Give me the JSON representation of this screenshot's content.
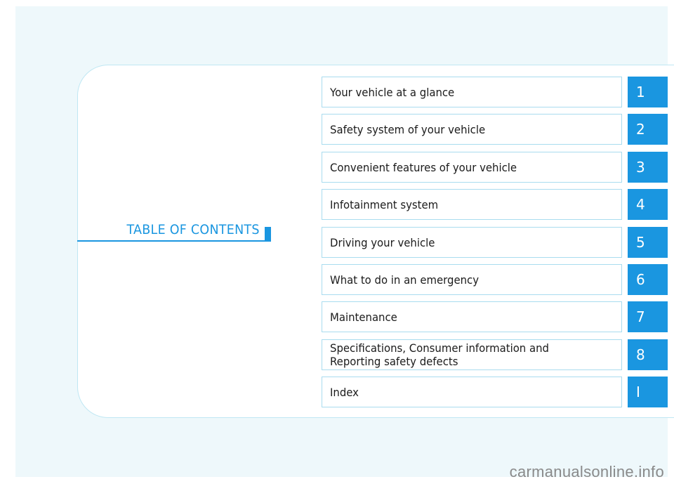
{
  "title": "TABLE OF CONTENTS",
  "colors": {
    "accent": "#1a96e0",
    "background": "#eef8fb",
    "border": "#a9dcef"
  },
  "chapters": [
    {
      "label": "Your vehicle at a glance",
      "number": "1"
    },
    {
      "label": "Safety system of your vehicle",
      "number": "2"
    },
    {
      "label": "Convenient features of your vehicle",
      "number": "3"
    },
    {
      "label": "Infotainment system",
      "number": "4"
    },
    {
      "label": "Driving your vehicle",
      "number": "5"
    },
    {
      "label": "What to do in an emergency",
      "number": "6"
    },
    {
      "label": "Maintenance",
      "number": "7"
    },
    {
      "label": "Specifications, Consumer information and\nReporting safety defects",
      "number": "8"
    },
    {
      "label": "Index",
      "number": "I"
    }
  ],
  "watermark": "carmanualsonline.info"
}
